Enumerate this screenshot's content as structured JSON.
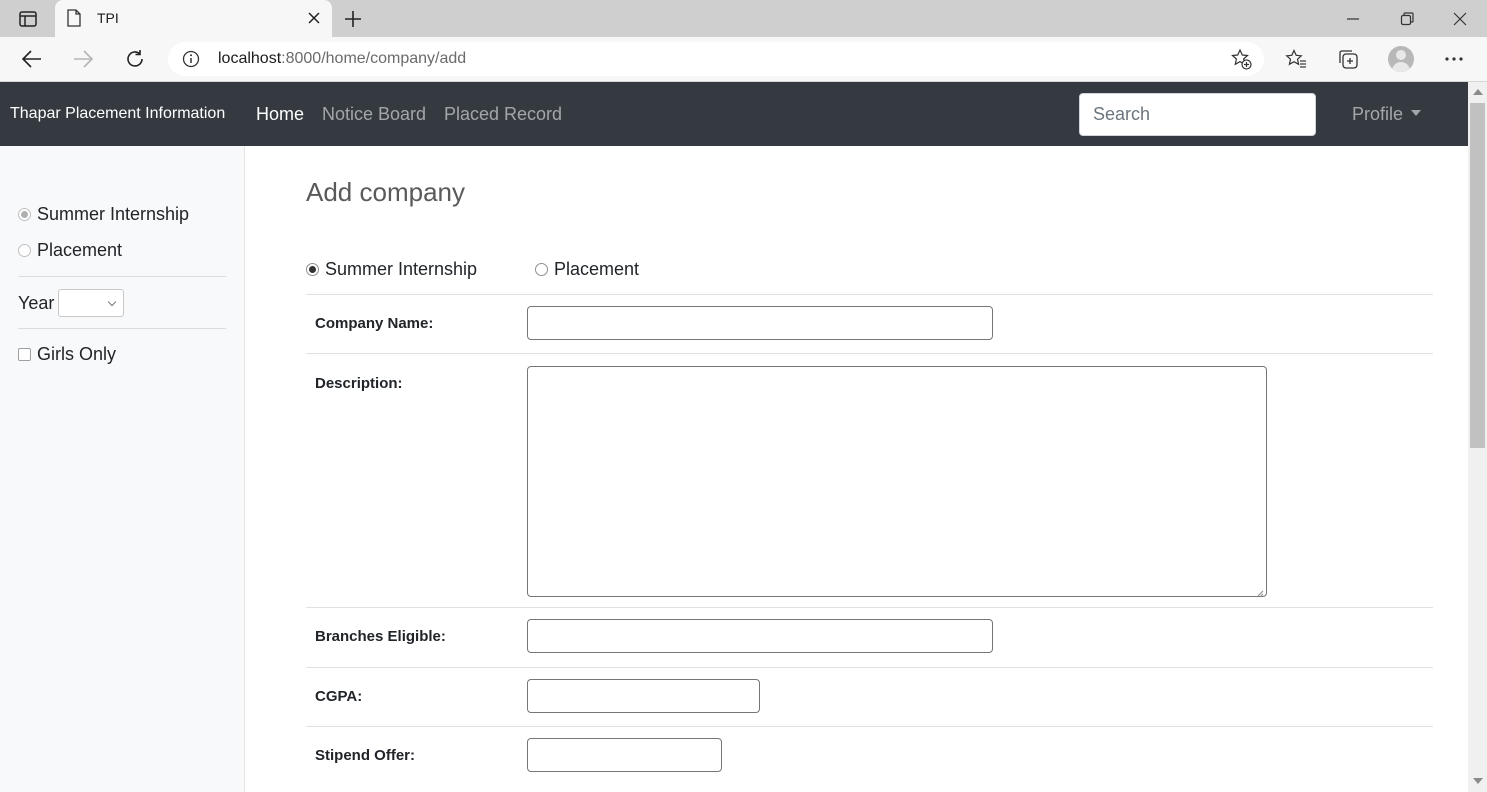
{
  "browser": {
    "tab_title": "TPI",
    "url_host": "localhost",
    "url_path": ":8000/home/company/add"
  },
  "navbar": {
    "brand": "Thapar Placement Information",
    "links": [
      {
        "label": "Home",
        "active": true
      },
      {
        "label": "Notice Board",
        "active": false
      },
      {
        "label": "Placed Record",
        "active": false
      }
    ],
    "search_placeholder": "Search",
    "profile_label": "Profile"
  },
  "sidebar": {
    "options": [
      {
        "label": "Summer Internship",
        "checked": true
      },
      {
        "label": "Placement",
        "checked": false
      }
    ],
    "year_label": "Year",
    "year_value": "",
    "girls_only_label": "Girls Only",
    "girls_only_checked": false
  },
  "main": {
    "title": "Add company",
    "type_options": [
      {
        "label": "Summer Internship",
        "checked": true
      },
      {
        "label": "Placement",
        "checked": false
      }
    ],
    "fields": {
      "company_name": {
        "label": "Company Name:",
        "value": ""
      },
      "description": {
        "label": "Description:",
        "value": ""
      },
      "branches": {
        "label": "Branches Eligible:",
        "value": ""
      },
      "cgpa": {
        "label": "CGPA:",
        "value": ""
      },
      "stipend": {
        "label": "Stipend Offer:",
        "value": ""
      }
    }
  },
  "icons": {
    "tab_menu": "tab-actions-icon",
    "tab_page": "page-icon",
    "tab_close": "close-icon",
    "new_tab": "plus-icon",
    "minimize": "minimize-icon",
    "restore": "restore-icon",
    "window_close": "close-icon",
    "back": "back-arrow-icon",
    "forward": "forward-arrow-icon",
    "refresh": "refresh-icon",
    "info": "info-icon",
    "add_favorite": "star-add-icon",
    "favorites": "favorites-icon",
    "collections": "collections-icon",
    "profile": "avatar-icon",
    "more": "more-icon"
  },
  "colors": {
    "navbar_bg": "#343a40",
    "sidebar_bg": "#f8f9fa"
  }
}
